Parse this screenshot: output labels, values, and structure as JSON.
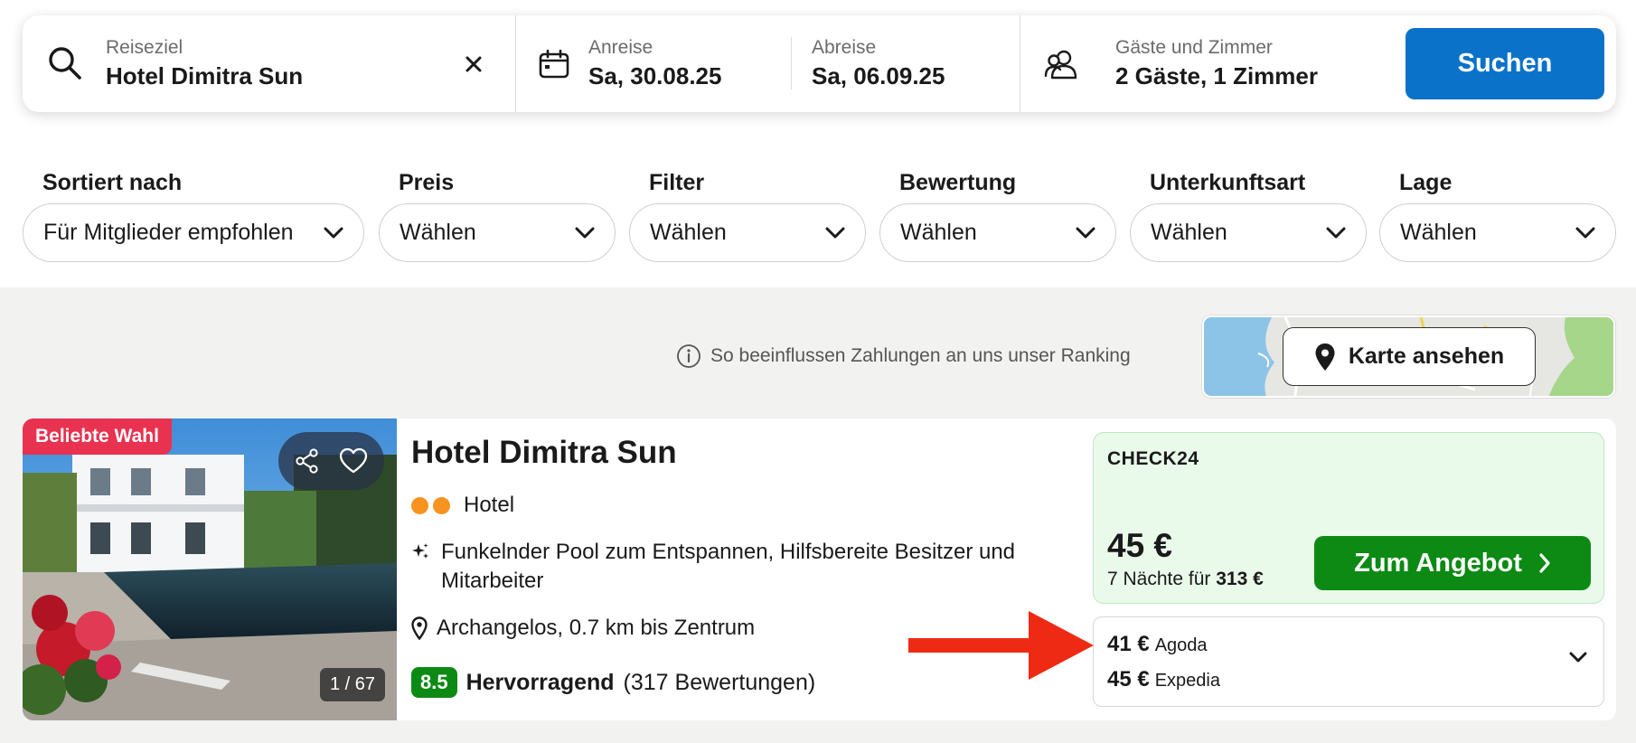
{
  "search": {
    "destination_label": "Reiseziel",
    "destination_value": "Hotel Dimitra Sun",
    "checkin_label": "Anreise",
    "checkin_value": "Sa, 30.08.25",
    "checkout_label": "Abreise",
    "checkout_value": "Sa, 06.09.25",
    "guests_label": "Gäste und Zimmer",
    "guests_value": "2 Gäste, 1 Zimmer",
    "button_label": "Suchen"
  },
  "filters": [
    {
      "label": "Sortiert nach",
      "value": "Für Mitglieder empfohlen"
    },
    {
      "label": "Preis",
      "value": "Wählen"
    },
    {
      "label": "Filter",
      "value": "Wählen"
    },
    {
      "label": "Bewertung",
      "value": "Wählen"
    },
    {
      "label": "Unterkunftsart",
      "value": "Wählen"
    },
    {
      "label": "Lage",
      "value": "Wählen"
    }
  ],
  "ranking_note": "So beeinflussen Zahlungen an uns unser Ranking",
  "map_button": "Karte ansehen",
  "hotel": {
    "badge": "Beliebte Wahl",
    "photo_count": "1 / 67",
    "name": "Hotel Dimitra Sun",
    "type": "Hotel",
    "highlight": "Funkelnder Pool zum Entspannen, Hilfsbereite Besitzer und Mitarbeiter",
    "location": "Archangelos, 0.7 km bis Zentrum",
    "score": "8.5",
    "rating_word": "Hervorragend",
    "reviews": "(317 Bewertungen)",
    "deal": {
      "provider": "CHECK24",
      "price": "45 €",
      "nights_prefix": "7 Nächte für",
      "nights_total": "313 €",
      "button": "Zum Angebot"
    },
    "other_offers": [
      {
        "price": "41 €",
        "provider": "Agoda"
      },
      {
        "price": "45 €",
        "provider": "Expedia"
      }
    ]
  },
  "colors": {
    "accent": "#0a72c9",
    "deal_green": "#0c8a14",
    "badge_red": "#e8324f",
    "annotation_arrow": "#ee2a14"
  }
}
